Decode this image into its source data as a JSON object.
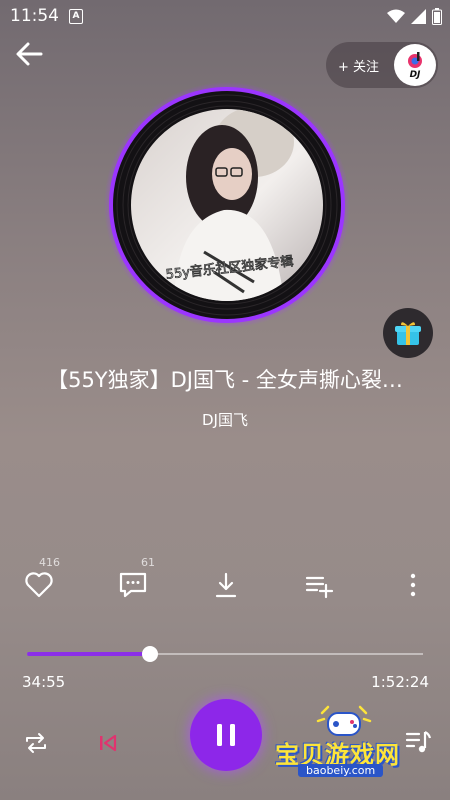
{
  "status_bar": {
    "time": "11:54",
    "badge_letter": "A"
  },
  "header": {
    "follow_label": "+ 关注",
    "logo_text": "DJ"
  },
  "album": {
    "caption": "55y音乐社区独家专辑"
  },
  "song": {
    "title": "【55Y独家】DJ国飞 - 全女声撕心裂…",
    "artist": "DJ国飞"
  },
  "actions": {
    "like_count": "416",
    "comment_count": "61"
  },
  "player": {
    "current_time": "34:55",
    "total_time": "1:52:24",
    "progress": 0.31
  },
  "watermark": {
    "title": "宝贝游戏网",
    "url": "baobeiy.com"
  },
  "colors": {
    "accent": "#8d27e9",
    "ring_glow": "#a13cff"
  }
}
